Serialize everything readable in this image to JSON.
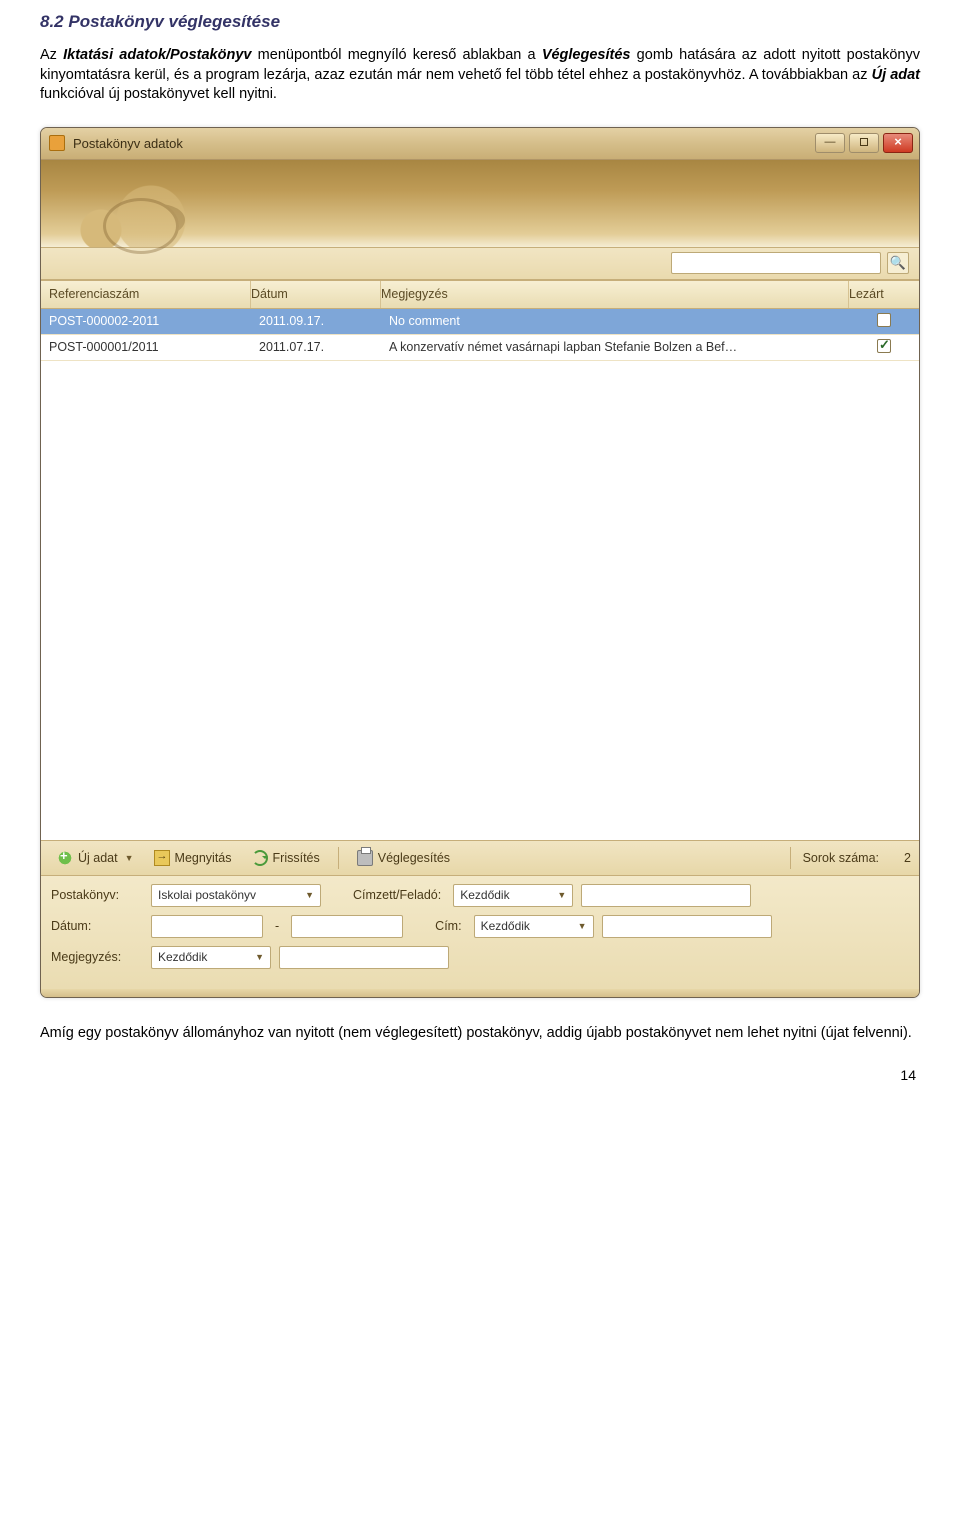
{
  "section_title": "8.2 Postakönyv véglegesítése",
  "para1_pre": "Az ",
  "para1_bi1": "Iktatási adatok/Postakönyv",
  "para1_mid1": " menüpontból megnyíló kereső ablakban a ",
  "para1_bi2": "Véglegesítés",
  "para1_mid2": " gomb hatására az adott nyitott postakönyv kinyomtatásra kerül, és a program lezárja, azaz ezután már nem vehető fel több tétel ehhez a postakönyvhöz. A továbbiakban az ",
  "para1_bi3": "Új adat",
  "para1_post": " funkcióval új postakönyvet kell nyitni.",
  "window": {
    "title": "Postakönyv adatok",
    "search_placeholder": ""
  },
  "columns": {
    "ref": "Referenciaszám",
    "date": "Dátum",
    "note": "Megjegyzés",
    "closed": "Lezárt"
  },
  "rows": [
    {
      "ref": "POST-000002-2011",
      "date": "2011.09.17.",
      "note": "No comment",
      "closed": false,
      "selected": true
    },
    {
      "ref": "POST-000001/2011",
      "date": "2011.07.17.",
      "note": "A konzervatív német vasárnapi lapban Stefanie Bolzen a Bef…",
      "closed": true,
      "selected": false
    }
  ],
  "toolbar": {
    "new": "Új adat",
    "open": "Megnyitás",
    "refresh": "Frissítés",
    "finalize": "Véglegesítés",
    "rowcount_label": "Sorok száma:",
    "rowcount": "2"
  },
  "filters": {
    "postakonyv_label": "Postakönyv:",
    "postakonyv_value": "Iskolai postakönyv",
    "cimzett_label": "Címzett/Feladó:",
    "cimzett_op": "Kezdődik",
    "datum_label": "Dátum:",
    "cim_label": "Cím:",
    "cim_op": "Kezdődik",
    "megj_label": "Megjegyzés:",
    "megj_op": "Kezdődik"
  },
  "para2": "Amíg egy postakönyv állományhoz van nyitott (nem véglegesített) postakönyv, addig újabb postakönyvet nem lehet nyitni (újat felvenni).",
  "page_number": "14"
}
